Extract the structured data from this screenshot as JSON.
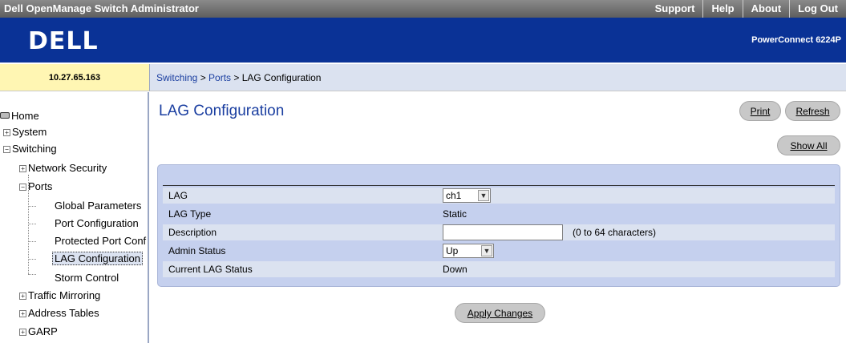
{
  "topbar": {
    "title": "Dell OpenManage Switch Administrator",
    "links": [
      "Support",
      "Help",
      "About",
      "Log Out"
    ]
  },
  "banner": {
    "logo": "DELL",
    "model": "PowerConnect 6224P"
  },
  "ip": "10.27.65.163",
  "breadcrumb": {
    "part1": "Switching",
    "sep1": " > ",
    "part2": "Ports",
    "sep2": " > ",
    "current": "LAG Configuration"
  },
  "sidebar": {
    "home": "Home",
    "system": "System",
    "switching": "Switching",
    "network_security": "Network Security",
    "ports": "Ports",
    "global_parameters": "Global Parameters",
    "port_configuration": "Port Configuration",
    "protected_port": "Protected Port Conf",
    "lag_configuration": "LAG Configuration",
    "storm_control": "Storm Control",
    "traffic_mirroring": "Traffic Mirroring",
    "address_tables": "Address Tables",
    "garp": "GARP"
  },
  "page": {
    "title": "LAG Configuration"
  },
  "buttons": {
    "print": "Print",
    "refresh": "Refresh",
    "show_all": "Show All",
    "apply": "Apply Changes"
  },
  "form": {
    "lag_label": "LAG",
    "lag_value": "ch1",
    "lag_type_label": "LAG Type",
    "lag_type_value": "Static",
    "description_label": "Description",
    "description_value": "",
    "description_hint": "(0 to 64 characters)",
    "admin_status_label": "Admin Status",
    "admin_status_value": "Up",
    "current_status_label": "Current LAG Status",
    "current_status_value": "Down"
  },
  "colors": {
    "banner": "#0a3296",
    "link": "#1a3ea0",
    "panel": "#c5d0ee",
    "ip_bg": "#fff6b3"
  }
}
